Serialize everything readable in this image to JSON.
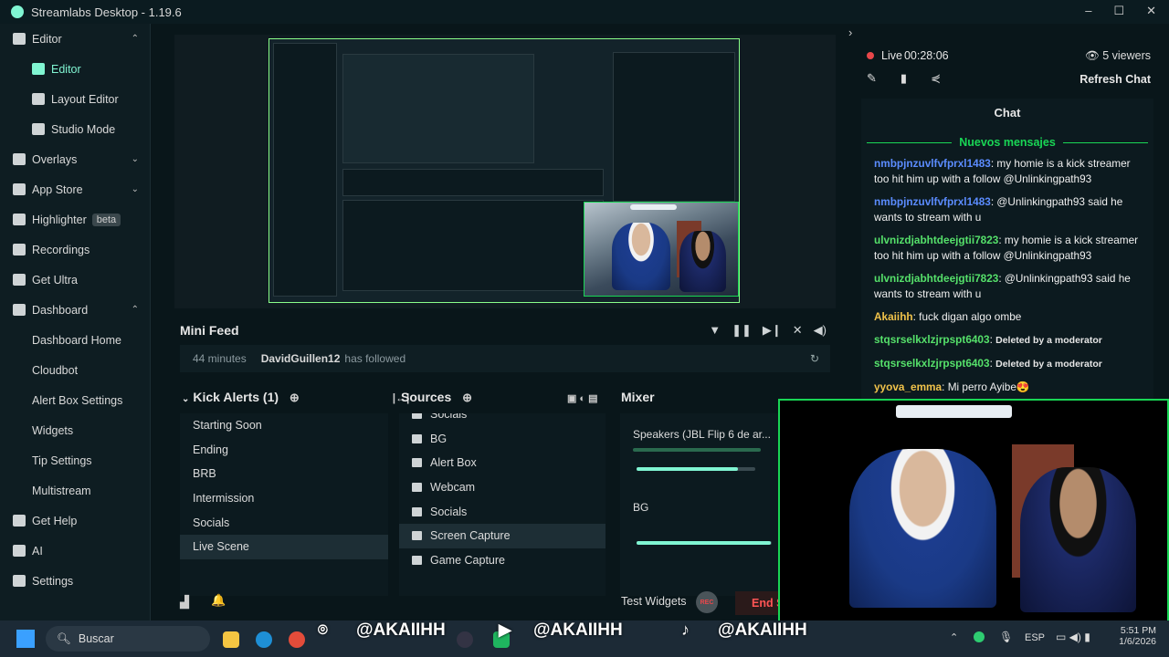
{
  "window": {
    "title": "Streamlabs Desktop - 1.19.6",
    "controls": [
      "–",
      "☐",
      "✕"
    ]
  },
  "sidebar": {
    "items": [
      {
        "label": "Editor",
        "icon": "editor-icon",
        "type": "top",
        "chevron": "⌃"
      },
      {
        "label": "Editor",
        "icon": "editor-icon",
        "type": "sub",
        "active": true
      },
      {
        "label": "Layout Editor",
        "icon": "layout-icon",
        "type": "sub"
      },
      {
        "label": "Studio Mode",
        "icon": "studio-icon",
        "type": "sub"
      },
      {
        "label": "Overlays",
        "icon": "overlays-icon",
        "type": "top",
        "chevron": "⌄"
      },
      {
        "label": "App Store",
        "icon": "store-icon",
        "type": "top",
        "chevron": "⌄"
      },
      {
        "label": "Highlighter",
        "icon": "highlighter-icon",
        "type": "top",
        "badge": "beta"
      },
      {
        "label": "Recordings",
        "icon": "recordings-icon",
        "type": "top"
      },
      {
        "label": "Get Ultra",
        "icon": "ultra-icon",
        "type": "top"
      },
      {
        "label": "Dashboard",
        "icon": "dashboard-icon",
        "type": "top",
        "chevron": "⌃"
      },
      {
        "label": "Dashboard Home",
        "type": "sub"
      },
      {
        "label": "Cloudbot",
        "type": "sub"
      },
      {
        "label": "Alert Box Settings",
        "type": "sub"
      },
      {
        "label": "Widgets",
        "type": "sub"
      },
      {
        "label": "Tip Settings",
        "type": "sub"
      },
      {
        "label": "Multistream",
        "type": "sub"
      },
      {
        "label": "Get Help",
        "icon": "help-icon",
        "type": "top"
      },
      {
        "label": "AI",
        "icon": "ai-icon",
        "type": "top"
      },
      {
        "label": "Settings",
        "icon": "gear-icon",
        "type": "top"
      }
    ]
  },
  "minifeed": {
    "title": "Mini Feed",
    "row": {
      "time": "44 minutes",
      "user": "DavidGuillen12",
      "action": "has followed"
    }
  },
  "scenes": {
    "title": "Kick Alerts (1)",
    "items": [
      "Starting Soon",
      "Ending",
      "BRB",
      "Intermission",
      "Socials",
      "Live Scene"
    ],
    "selected": "Live Scene"
  },
  "sources": {
    "title": "Sources",
    "items": [
      {
        "label": "Socials",
        "icon": "scene-icon"
      },
      {
        "label": "BG",
        "icon": "image-icon"
      },
      {
        "label": "Alert Box",
        "icon": "alertbox-icon"
      },
      {
        "label": "Webcam",
        "icon": "folder-icon"
      },
      {
        "label": "Socials",
        "icon": "scene-icon"
      },
      {
        "label": "Screen Capture",
        "icon": "screen-icon"
      },
      {
        "label": "Game Capture",
        "icon": "gamepad-icon"
      }
    ],
    "selected": "Screen Capture"
  },
  "mixer": {
    "title": "Mixer",
    "channels": [
      {
        "name": "Speakers (JBL Flip 6 de ar...",
        "volume": 0.85
      },
      {
        "name": "BG",
        "volume": 0.99
      }
    ]
  },
  "footer": {
    "test_widgets": "Test Widgets",
    "rec": "REC",
    "end_stream": "End S"
  },
  "chat": {
    "live_label": "Live",
    "live_time": "00:28:06",
    "viewers": "5 viewers",
    "refresh": "Refresh Chat",
    "title": "Chat",
    "divider": "Nuevos mensajes",
    "messages": [
      {
        "user": "nmbpjnzuvlfvfprxl1483",
        "text": "my homie is a kick streamer too hit him up with a follow @Unlinkingpath93",
        "cls": "u1"
      },
      {
        "user": "nmbpjnzuvlfvfprxl1483",
        "text": "@Unlinkingpath93 said he wants to stream with u",
        "cls": "u1"
      },
      {
        "user": "ulvnizdjabhtdeejgtii7823",
        "text": "my homie is a kick streamer too hit him up with a follow @Unlinkingpath93",
        "cls": "u2"
      },
      {
        "user": "ulvnizdjabhtdeejgtii7823",
        "text": "@Unlinkingpath93 said he wants to stream with u",
        "cls": "u2"
      },
      {
        "user": "Akaiihh",
        "text": "fuck digan algo ombe",
        "cls": "u3"
      },
      {
        "user": "stqsrselkxlzjrpspt6403",
        "text": "Deleted by a moderator",
        "cls": "u2",
        "deleted": true
      },
      {
        "user": "stqsrselkxlzjrpspt6403",
        "text": "Deleted by a moderator",
        "cls": "u2",
        "deleted": true
      },
      {
        "user": "yyova_emma",
        "text": "Mi perro Ayibe😍",
        "cls": "u3"
      }
    ]
  },
  "overlay": {
    "handle1": "@AKAIIHH",
    "handle2": "@AKAIIHH",
    "handle3": "@AKAIIHH"
  },
  "taskbar": {
    "search": "Buscar",
    "lang": "ESP",
    "time": "5:51 PM",
    "date": "1/6/2026"
  },
  "colors": {
    "accent": "#80f5d2",
    "live": "#e8474a",
    "frame": "#19d655"
  }
}
